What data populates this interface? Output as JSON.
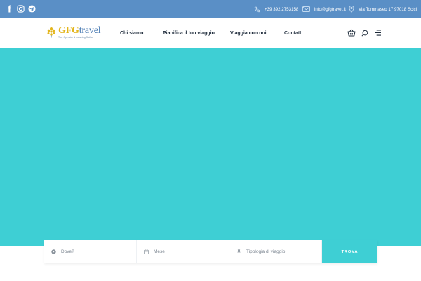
{
  "topbar": {
    "social": [
      {
        "icon": "facebook-icon"
      },
      {
        "icon": "instagram-icon"
      },
      {
        "icon": "telegram-icon"
      }
    ],
    "phone": "+39 392 2753158",
    "email": "info@gfgtravel.it",
    "address": "Via Tommaseo 17 97018 Scicli"
  },
  "header": {
    "logo": {
      "brand_bold": "GFG",
      "brand_rest": "travel",
      "tagline": "Tour Operator & Incoming Sicilia"
    },
    "nav": [
      {
        "label": "Chi siamo"
      },
      {
        "label": "Pianifica il tuo viaggio"
      },
      {
        "label": "Viaggia con noi"
      },
      {
        "label": "Contatti"
      }
    ],
    "icons": [
      "basket-icon",
      "search-icon",
      "menu-icon"
    ]
  },
  "search": {
    "where_placeholder": "Dove?",
    "month_placeholder": "Mese",
    "type_placeholder": "Tipologia di viaggio",
    "submit_label": "TROVA"
  },
  "colors": {
    "topbar": "#5a8fc6",
    "hero": "#3ecfd4",
    "accent": "#3ecfd4"
  }
}
